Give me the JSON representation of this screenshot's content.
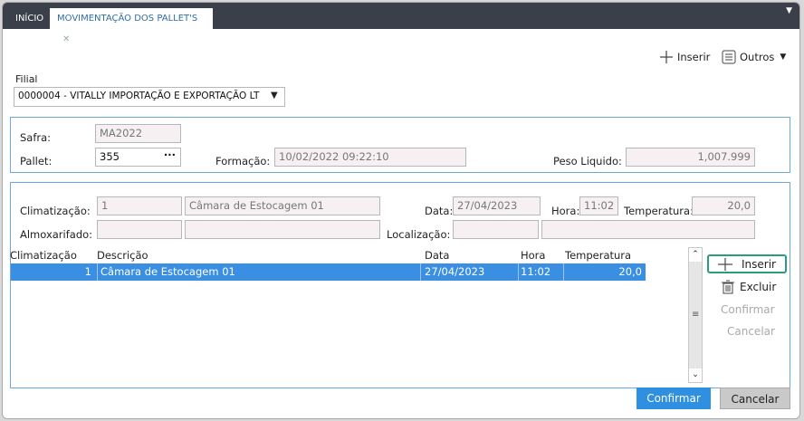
{
  "tabs": {
    "home": "INÍCIO",
    "active": "MOVIMENTAÇÃO DOS PALLET'S",
    "close": "✕"
  },
  "toolbar": {
    "insert": "Inserir",
    "others": "Outros"
  },
  "filial": {
    "label": "Filial",
    "value": "0000004 - VITALLY IMPORTAÇÃO E EXPORTAÇÃO LT"
  },
  "header_panel": {
    "safra_label": "Safra:",
    "safra_value": "MA2022",
    "pallet_label": "Pallet:",
    "pallet_value": "355",
    "formacao_label": "Formação:",
    "formacao_value": "10/02/2022 09:22:10",
    "peso_label": "Peso Liquido:",
    "peso_value": "1,007.999"
  },
  "detail_panel": {
    "climat_label": "Climatização:",
    "climat_code": "1",
    "climat_desc": "Câmara de Estocagem 01",
    "data_label": "Data:",
    "data_value": "27/04/2023",
    "hora_label": "Hora:",
    "hora_value": "11:02",
    "temp_label": "Temperatura:",
    "temp_value": "20,0",
    "almox_label": "Almoxarifado:",
    "almox_code": "",
    "almox_desc": "",
    "local_label": "Localização:",
    "local_code": "",
    "local_desc": ""
  },
  "grid": {
    "columns": [
      "Climatização",
      "Descrição",
      "Data",
      "Hora",
      "Temperatura"
    ],
    "rows": [
      {
        "climatizacao": "1",
        "descricao": "Câmara de Estocagem 01",
        "data": "27/04/2023",
        "hora": "11:02",
        "temperatura": "20,0"
      }
    ]
  },
  "side_actions": {
    "insert": "Inserir",
    "delete": "Excluir",
    "confirm": "Confirmar",
    "cancel": "Cancelar"
  },
  "footer": {
    "confirm": "Confirmar",
    "cancel": "Cancelar"
  },
  "colors": {
    "accent": "#2f8fe0",
    "selection": "#3a8fe3",
    "topbar": "#3b3f4a",
    "insert_border": "#2a9d7a"
  }
}
